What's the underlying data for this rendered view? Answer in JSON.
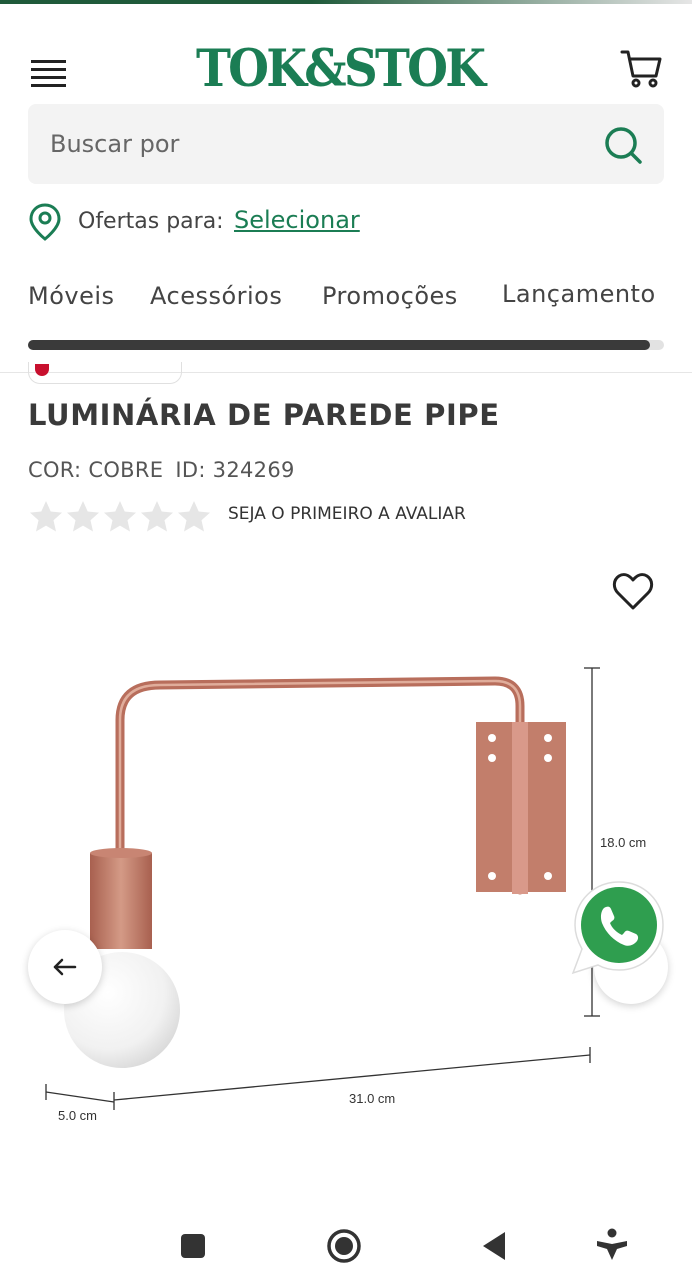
{
  "header": {
    "logo_text": "TOK&STOK",
    "brand_color": "#1b7d54"
  },
  "search": {
    "placeholder": "Buscar por"
  },
  "offers": {
    "label": "Ofertas para:",
    "link": "Selecionar"
  },
  "categories": [
    "Móveis",
    "Acessórios",
    "Promoções",
    "Lançamento"
  ],
  "product": {
    "title": "LUMINÁRIA DE PAREDE PIPE",
    "color_label": "COR: COBRE",
    "id_label": "ID: 324269",
    "rating": 0,
    "rating_max": 5,
    "review_cta": "SEJA O PRIMEIRO A AVALIAR"
  },
  "image": {
    "dim_height": "18.0 cm",
    "dim_width": "31.0 cm",
    "dim_depth": "5.0 cm",
    "material_color": "#c27e6b"
  },
  "icons": [
    "menu-icon",
    "cart-icon",
    "search-icon",
    "location-pin-icon",
    "star-icon",
    "heart-icon",
    "arrow-left-icon",
    "whatsapp-icon"
  ]
}
